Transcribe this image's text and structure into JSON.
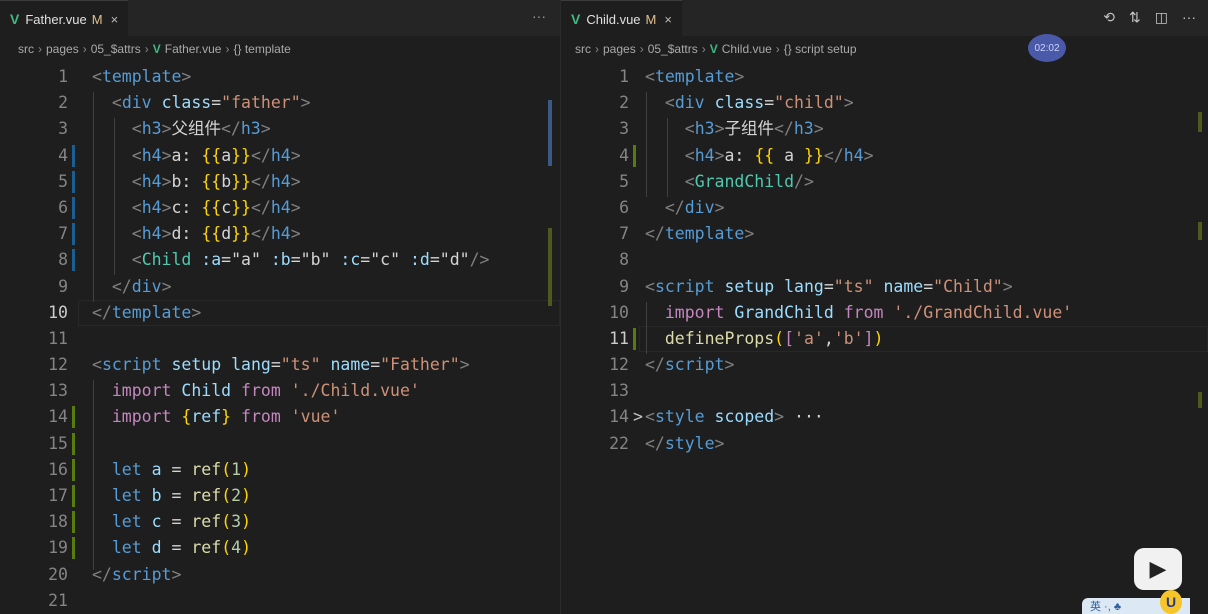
{
  "left": {
    "tab": {
      "name": "Father.vue",
      "status": "M",
      "close": "×"
    },
    "tab_more": "···",
    "breadcrumb": [
      "src",
      "pages",
      "05_$attrs",
      "Father.vue",
      "{} template"
    ],
    "lines": [
      {
        "n": "1",
        "t": [
          [
            "p",
            "<"
          ],
          [
            "t",
            "template"
          ],
          [
            "p",
            ">"
          ]
        ]
      },
      {
        "n": "2",
        "t": [
          [
            "w",
            "  "
          ],
          [
            "p",
            "<"
          ],
          [
            "t",
            "div"
          ],
          [
            "w",
            " "
          ],
          [
            "a",
            "class"
          ],
          [
            "w",
            "="
          ],
          [
            "s",
            "\"father\""
          ],
          [
            "p",
            ">"
          ]
        ]
      },
      {
        "n": "3",
        "t": [
          [
            "w",
            "    "
          ],
          [
            "p",
            "<"
          ],
          [
            "t",
            "h3"
          ],
          [
            "p",
            ">"
          ],
          [
            "w",
            "父组件"
          ],
          [
            "p",
            "</"
          ],
          [
            "t",
            "h3"
          ],
          [
            "p",
            ">"
          ]
        ]
      },
      {
        "n": "4",
        "t": [
          [
            "w",
            "    "
          ],
          [
            "p",
            "<"
          ],
          [
            "t",
            "h4"
          ],
          [
            "p",
            ">"
          ],
          [
            "w",
            "a: "
          ],
          [
            "y",
            "{{"
          ],
          [
            "w",
            "a"
          ],
          [
            "y",
            "}}"
          ],
          [
            "p",
            "</"
          ],
          [
            "t",
            "h4"
          ],
          [
            "p",
            ">"
          ]
        ]
      },
      {
        "n": "5",
        "t": [
          [
            "w",
            "    "
          ],
          [
            "p",
            "<"
          ],
          [
            "t",
            "h4"
          ],
          [
            "p",
            ">"
          ],
          [
            "w",
            "b: "
          ],
          [
            "y",
            "{{"
          ],
          [
            "w",
            "b"
          ],
          [
            "y",
            "}}"
          ],
          [
            "p",
            "</"
          ],
          [
            "t",
            "h4"
          ],
          [
            "p",
            ">"
          ]
        ]
      },
      {
        "n": "6",
        "t": [
          [
            "w",
            "    "
          ],
          [
            "p",
            "<"
          ],
          [
            "t",
            "h4"
          ],
          [
            "p",
            ">"
          ],
          [
            "w",
            "c: "
          ],
          [
            "y",
            "{{"
          ],
          [
            "w",
            "c"
          ],
          [
            "y",
            "}}"
          ],
          [
            "p",
            "</"
          ],
          [
            "t",
            "h4"
          ],
          [
            "p",
            ">"
          ]
        ]
      },
      {
        "n": "7",
        "t": [
          [
            "w",
            "    "
          ],
          [
            "p",
            "<"
          ],
          [
            "t",
            "h4"
          ],
          [
            "p",
            ">"
          ],
          [
            "w",
            "d: "
          ],
          [
            "y",
            "{{"
          ],
          [
            "w",
            "d"
          ],
          [
            "y",
            "}}"
          ],
          [
            "p",
            "</"
          ],
          [
            "t",
            "h4"
          ],
          [
            "p",
            ">"
          ]
        ]
      },
      {
        "n": "8",
        "t": [
          [
            "w",
            "    "
          ],
          [
            "p",
            "<"
          ],
          [
            "c",
            "Child"
          ],
          [
            "w",
            " "
          ],
          [
            "a",
            ":a"
          ],
          [
            "w",
            "="
          ],
          [
            "w",
            "\"a\""
          ],
          [
            "w",
            " "
          ],
          [
            "a",
            ":b"
          ],
          [
            "w",
            "="
          ],
          [
            "w",
            "\"b\""
          ],
          [
            "w",
            " "
          ],
          [
            "a",
            ":c"
          ],
          [
            "w",
            "="
          ],
          [
            "w",
            "\"c\""
          ],
          [
            "w",
            " "
          ],
          [
            "a",
            ":d"
          ],
          [
            "w",
            "="
          ],
          [
            "w",
            "\"d\""
          ],
          [
            "p",
            "/>"
          ]
        ]
      },
      {
        "n": "9",
        "t": [
          [
            "w",
            "  "
          ],
          [
            "p",
            "</"
          ],
          [
            "t",
            "div"
          ],
          [
            "p",
            ">"
          ]
        ]
      },
      {
        "n": "10",
        "t": [
          [
            "p",
            "</"
          ],
          [
            "t",
            "template"
          ],
          [
            "p",
            ">"
          ]
        ]
      },
      {
        "n": "11",
        "t": []
      },
      {
        "n": "12",
        "t": [
          [
            "p",
            "<"
          ],
          [
            "t",
            "script"
          ],
          [
            "w",
            " "
          ],
          [
            "a",
            "setup"
          ],
          [
            "w",
            " "
          ],
          [
            "a",
            "lang"
          ],
          [
            "w",
            "="
          ],
          [
            "s",
            "\"ts\""
          ],
          [
            "w",
            " "
          ],
          [
            "a",
            "name"
          ],
          [
            "w",
            "="
          ],
          [
            "s",
            "\"Father\""
          ],
          [
            "p",
            ">"
          ]
        ]
      },
      {
        "n": "13",
        "t": [
          [
            "w",
            "  "
          ],
          [
            "k",
            "import"
          ],
          [
            "w",
            " "
          ],
          [
            "v",
            "Child"
          ],
          [
            "w",
            " "
          ],
          [
            "k",
            "from"
          ],
          [
            "w",
            " "
          ],
          [
            "s",
            "'./Child.vue'"
          ]
        ]
      },
      {
        "n": "14",
        "t": [
          [
            "w",
            "  "
          ],
          [
            "k",
            "import"
          ],
          [
            "w",
            " "
          ],
          [
            "y",
            "{"
          ],
          [
            "v",
            "ref"
          ],
          [
            "y",
            "}"
          ],
          [
            "w",
            " "
          ],
          [
            "k",
            "from"
          ],
          [
            "w",
            " "
          ],
          [
            "s",
            "'vue'"
          ]
        ]
      },
      {
        "n": "15",
        "t": []
      },
      {
        "n": "16",
        "t": [
          [
            "w",
            "  "
          ],
          [
            "kw",
            "let"
          ],
          [
            "w",
            " "
          ],
          [
            "v",
            "a"
          ],
          [
            "w",
            " = "
          ],
          [
            "f",
            "ref"
          ],
          [
            "y",
            "("
          ],
          [
            "n",
            "1"
          ],
          [
            "y",
            ")"
          ]
        ]
      },
      {
        "n": "17",
        "t": [
          [
            "w",
            "  "
          ],
          [
            "kw",
            "let"
          ],
          [
            "w",
            " "
          ],
          [
            "v",
            "b"
          ],
          [
            "w",
            " = "
          ],
          [
            "f",
            "ref"
          ],
          [
            "y",
            "("
          ],
          [
            "n",
            "2"
          ],
          [
            "y",
            ")"
          ]
        ]
      },
      {
        "n": "18",
        "t": [
          [
            "w",
            "  "
          ],
          [
            "kw",
            "let"
          ],
          [
            "w",
            " "
          ],
          [
            "v",
            "c"
          ],
          [
            "w",
            " = "
          ],
          [
            "f",
            "ref"
          ],
          [
            "y",
            "("
          ],
          [
            "n",
            "3"
          ],
          [
            "y",
            ")"
          ]
        ]
      },
      {
        "n": "19",
        "t": [
          [
            "w",
            "  "
          ],
          [
            "kw",
            "let"
          ],
          [
            "w",
            " "
          ],
          [
            "v",
            "d"
          ],
          [
            "w",
            " = "
          ],
          [
            "f",
            "ref"
          ],
          [
            "y",
            "("
          ],
          [
            "n",
            "4"
          ],
          [
            "y",
            ")"
          ]
        ]
      },
      {
        "n": "20",
        "t": [
          [
            "p",
            "</"
          ],
          [
            "t",
            "script"
          ],
          [
            "p",
            ">"
          ]
        ]
      },
      {
        "n": "21",
        "t": []
      }
    ]
  },
  "right": {
    "tab": {
      "name": "Child.vue",
      "status": "M",
      "close": "×"
    },
    "breadcrumb": [
      "src",
      "pages",
      "05_$attrs",
      "Child.vue",
      "{} script setup"
    ],
    "timer": "02:02",
    "lines": [
      {
        "n": "1",
        "t": [
          [
            "p",
            "<"
          ],
          [
            "t",
            "template"
          ],
          [
            "p",
            ">"
          ]
        ]
      },
      {
        "n": "2",
        "t": [
          [
            "w",
            "  "
          ],
          [
            "p",
            "<"
          ],
          [
            "t",
            "div"
          ],
          [
            "w",
            " "
          ],
          [
            "a",
            "class"
          ],
          [
            "w",
            "="
          ],
          [
            "s",
            "\"child\""
          ],
          [
            "p",
            ">"
          ]
        ]
      },
      {
        "n": "3",
        "t": [
          [
            "w",
            "    "
          ],
          [
            "p",
            "<"
          ],
          [
            "t",
            "h3"
          ],
          [
            "p",
            ">"
          ],
          [
            "w",
            "子组件"
          ],
          [
            "p",
            "</"
          ],
          [
            "t",
            "h3"
          ],
          [
            "p",
            ">"
          ]
        ]
      },
      {
        "n": "4",
        "t": [
          [
            "w",
            "    "
          ],
          [
            "p",
            "<"
          ],
          [
            "t",
            "h4"
          ],
          [
            "p",
            ">"
          ],
          [
            "w",
            "a: "
          ],
          [
            "y",
            "{{"
          ],
          [
            "w",
            " a "
          ],
          [
            "y",
            "}}"
          ],
          [
            "p",
            "</"
          ],
          [
            "t",
            "h4"
          ],
          [
            "p",
            ">"
          ]
        ]
      },
      {
        "n": "5",
        "t": [
          [
            "w",
            "    "
          ],
          [
            "p",
            "<"
          ],
          [
            "c",
            "GrandChild"
          ],
          [
            "p",
            "/>"
          ]
        ]
      },
      {
        "n": "6",
        "t": [
          [
            "w",
            "  "
          ],
          [
            "p",
            "</"
          ],
          [
            "t",
            "div"
          ],
          [
            "p",
            ">"
          ]
        ]
      },
      {
        "n": "7",
        "t": [
          [
            "p",
            "</"
          ],
          [
            "t",
            "template"
          ],
          [
            "p",
            ">"
          ]
        ]
      },
      {
        "n": "8",
        "t": []
      },
      {
        "n": "9",
        "t": [
          [
            "p",
            "<"
          ],
          [
            "t",
            "script"
          ],
          [
            "w",
            " "
          ],
          [
            "a",
            "setup"
          ],
          [
            "w",
            " "
          ],
          [
            "a",
            "lang"
          ],
          [
            "w",
            "="
          ],
          [
            "s",
            "\"ts\""
          ],
          [
            "w",
            " "
          ],
          [
            "a",
            "name"
          ],
          [
            "w",
            "="
          ],
          [
            "s",
            "\"Child\""
          ],
          [
            "p",
            ">"
          ]
        ]
      },
      {
        "n": "10",
        "t": [
          [
            "w",
            "  "
          ],
          [
            "k",
            "import"
          ],
          [
            "w",
            " "
          ],
          [
            "v",
            "GrandChild"
          ],
          [
            "w",
            " "
          ],
          [
            "k",
            "from"
          ],
          [
            "w",
            " "
          ],
          [
            "s",
            "'./GrandChild.vue'"
          ]
        ]
      },
      {
        "n": "11",
        "t": [
          [
            "w",
            "  "
          ],
          [
            "f",
            "defineProps"
          ],
          [
            "y",
            "("
          ],
          [
            "k",
            "["
          ],
          [
            "s",
            "'a'"
          ],
          [
            "w",
            ","
          ],
          [
            "s",
            "'b'"
          ],
          [
            "k",
            "]"
          ],
          [
            "y",
            ")"
          ]
        ]
      },
      {
        "n": "12",
        "t": [
          [
            "p",
            "</"
          ],
          [
            "t",
            "script"
          ],
          [
            "p",
            ">"
          ]
        ]
      },
      {
        "n": "13",
        "t": []
      },
      {
        "n": "14",
        "fold": ">",
        "t": [
          [
            "p",
            "<"
          ],
          [
            "t",
            "style"
          ],
          [
            "w",
            " "
          ],
          [
            "a",
            "scoped"
          ],
          [
            "p",
            ">"
          ],
          [
            "w",
            " ···"
          ]
        ]
      },
      {
        "n": "22",
        "t": [
          [
            "p",
            "</"
          ],
          [
            "t",
            "style"
          ],
          [
            "p",
            ">"
          ]
        ]
      }
    ]
  },
  "overlay": {
    "ime": "英 ·, ♣",
    "ime_u": "U",
    "bili_play": "▶"
  }
}
